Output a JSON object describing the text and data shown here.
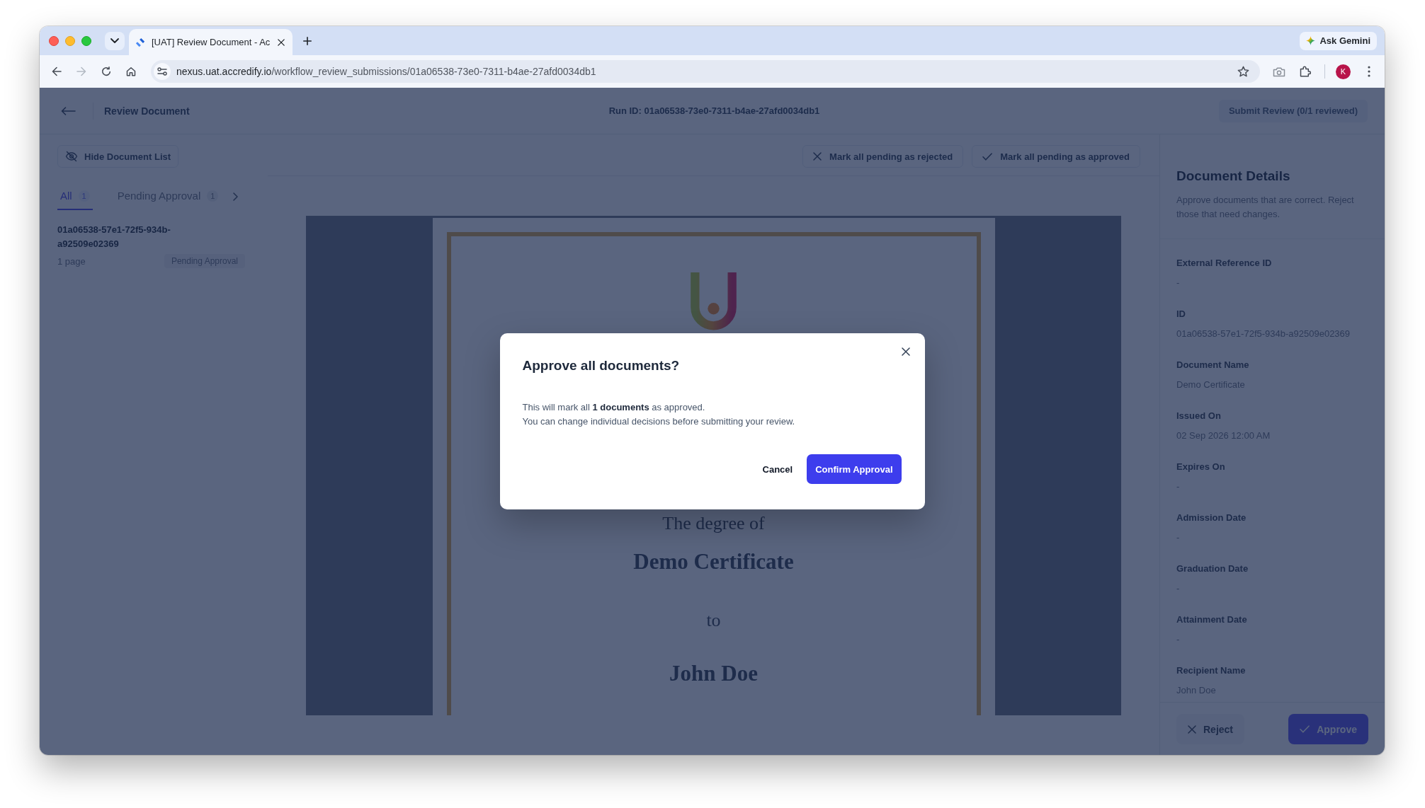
{
  "browser": {
    "tab": {
      "title": "[UAT] Review Document - Ac"
    },
    "assistant": "Ask Gemini",
    "nav": [
      {
        "kind": "back",
        "disabled": false
      },
      {
        "kind": "forward",
        "disabled": true
      },
      {
        "kind": "reload",
        "disabled": false
      },
      {
        "kind": "home",
        "disabled": false
      }
    ],
    "url": {
      "host": "nexus.uat.accredify.io",
      "path": "/workflow_review_submissions/01a06538-73e0-7311-b4ae-27afd0034db1"
    },
    "avatar": "K"
  },
  "header": {
    "title": "Review Document",
    "run_id": "Run ID: 01a06538-73e0-7311-b4ae-27afd0034db1",
    "submit": {
      "label": "Submit Review (0/1 reviewed)",
      "disabled": true
    }
  },
  "sidebar": {
    "toggle": "Hide Document List",
    "tabs": [
      {
        "label": "All",
        "count": "1",
        "selected": true
      },
      {
        "label": "Pending Approval",
        "count": "1",
        "selected": false
      }
    ],
    "documents": [
      {
        "name": "01a06538-57e1-72f5-934b-a92509e02369",
        "pages": "1 page",
        "status": "Pending Approval"
      }
    ]
  },
  "toolbar": {
    "buttons": [
      {
        "kind": "reject",
        "label": "Mark all pending as rejected"
      },
      {
        "kind": "approve",
        "label": "Mark all pending as approved"
      }
    ]
  },
  "certificate": {
    "lines": [
      {
        "kind": "intro",
        "text": "The degree of"
      },
      {
        "kind": "title",
        "text": "Demo Certificate"
      },
      {
        "kind": "connector",
        "text": "to"
      },
      {
        "kind": "name",
        "text": "John Doe"
      }
    ]
  },
  "details": {
    "title": "Document Details",
    "description": "Approve documents that are correct. Reject those that need changes.",
    "fields": [
      {
        "label": "External Reference ID",
        "value": "-"
      },
      {
        "label": "ID",
        "value": "01a06538-57e1-72f5-934b-a92509e02369"
      },
      {
        "label": "Document Name",
        "value": "Demo Certificate"
      },
      {
        "label": "Issued On",
        "value": "02 Sep 2026 12:00 AM"
      },
      {
        "label": "Expires On",
        "value": "-"
      },
      {
        "label": "Admission Date",
        "value": "-"
      },
      {
        "label": "Graduation Date",
        "value": "-"
      },
      {
        "label": "Attainment Date",
        "value": "-"
      },
      {
        "label": "Recipient Name",
        "value": "John Doe"
      }
    ],
    "actions": [
      {
        "kind": "reject",
        "label": "Reject"
      },
      {
        "kind": "approve",
        "label": "Approve"
      }
    ]
  },
  "dialog": {
    "title": "Approve all documents?",
    "message": [
      "This will mark all **1 documents** as approved.",
      "You can change individual decisions before submitting your review."
    ],
    "buttons": [
      {
        "kind": "secondary",
        "label": "Cancel"
      },
      {
        "kind": "primary",
        "label": "Confirm Approval"
      }
    ]
  }
}
